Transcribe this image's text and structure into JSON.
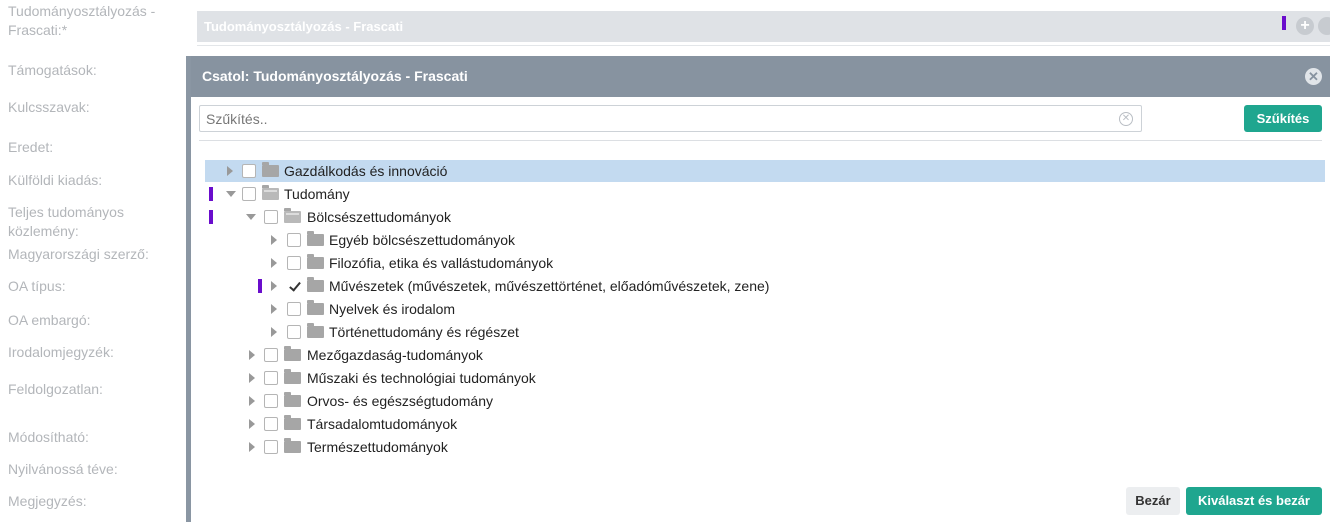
{
  "form": {
    "labels": [
      "Tudományosztályozás -",
      "Frascati:",
      "Támogatások:",
      "Kulcsszavak:",
      "Eredet:",
      "Külföldi kiadás:",
      "Teljes tudományos",
      "közlemény:",
      "Magyarországi szerző:",
      "OA típus:",
      "OA embargó:",
      "Irodalomjegyzék:",
      "Feldolgozatlan:",
      "Módosítható:",
      "Nyilvánossá téve:",
      "Megjegyzés:"
    ],
    "required_mark": "*",
    "field_value": "Tudományosztályozás - Frascati"
  },
  "modal": {
    "title": "Csatol: Tudományosztályozás - Frascati",
    "search_placeholder": "Szűkítés..",
    "search_button": "Szűkítés",
    "close_button": "Bezár",
    "select_button": "Kiválaszt és bezár"
  },
  "tree": [
    {
      "label": "Gazdálkodás és innováció",
      "checked": false,
      "expanded": false,
      "selected": true
    },
    {
      "label": "Tudomány",
      "checked": false,
      "expanded": true
    },
    {
      "label": "Bölcsészettudományok",
      "checked": false,
      "expanded": true
    },
    {
      "label": "Egyéb bölcsészettudományok",
      "checked": false,
      "expanded": false
    },
    {
      "label": "Filozófia, etika és vallástudományok",
      "checked": false,
      "expanded": false
    },
    {
      "label": "Művészetek (művészetek, művészettörténet, előadóművészetek, zene)",
      "checked": true,
      "expanded": false
    },
    {
      "label": "Nyelvek és irodalom",
      "checked": false,
      "expanded": false
    },
    {
      "label": "Történettudomány és régészet",
      "checked": false,
      "expanded": false
    },
    {
      "label": "Mezőgazdaság-tudományok",
      "checked": false,
      "expanded": false
    },
    {
      "label": "Műszaki és technológiai tudományok",
      "checked": false,
      "expanded": false
    },
    {
      "label": "Orvos- és egészségtudomány",
      "checked": false,
      "expanded": false
    },
    {
      "label": "Társadalomtudományok",
      "checked": false,
      "expanded": false
    },
    {
      "label": "Természettudományok",
      "checked": false,
      "expanded": false
    }
  ],
  "colors": {
    "accent": "#1fa68f",
    "header": "#8793a0",
    "marker": "#6a0dcc",
    "selected_row": "#c3daf0"
  }
}
